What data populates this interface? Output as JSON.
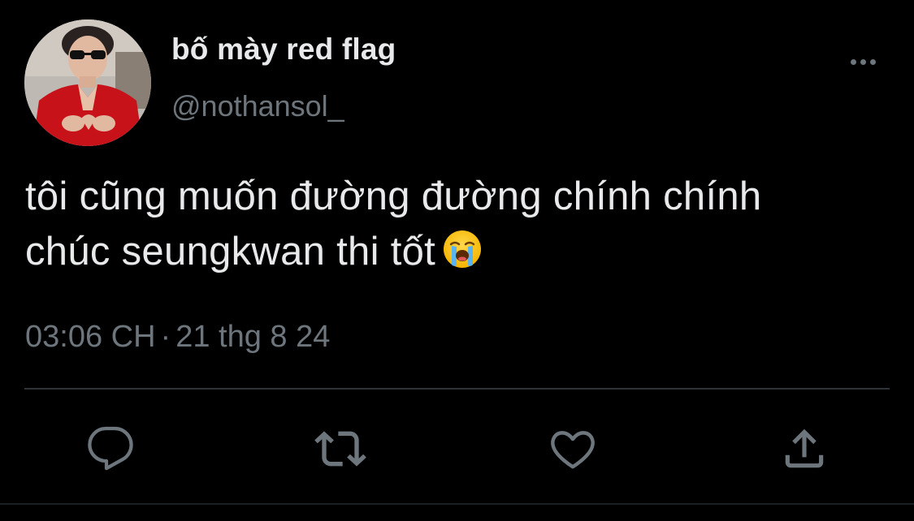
{
  "tweet": {
    "author": {
      "display_name": "bố mày red flag",
      "handle": "@nothansol_",
      "avatar": "profile-photo"
    },
    "text_lines": [
      "tôi cũng muốn đường đường chính chính",
      "chúc seungkwan thi tốt"
    ],
    "emoji": "loudly-crying-face",
    "time": "03:06 CH",
    "separator": "·",
    "date": "21 thg 8 24"
  },
  "actions": {
    "reply_icon": "reply-icon",
    "retweet_icon": "retweet-icon",
    "like_icon": "heart-icon",
    "share_icon": "share-icon"
  },
  "colors": {
    "background": "#000000",
    "primary_text": "#e7e9ea",
    "secondary_text": "#6e767d",
    "divider": "#2f3336"
  }
}
